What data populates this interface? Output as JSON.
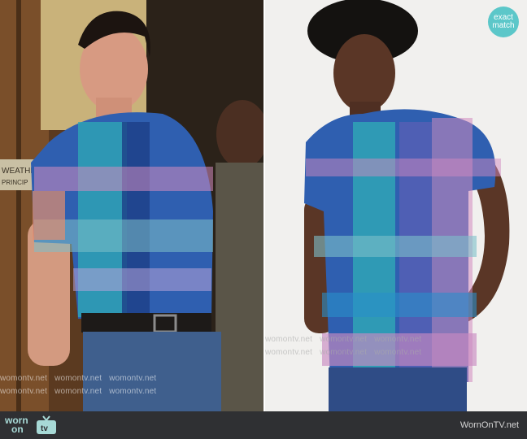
{
  "left_photo": {
    "door_sign_lines": [
      "WEATHE",
      "PRINCIP"
    ],
    "watermarks": [
      "womontv.net",
      "womontv.net",
      "womontv.net",
      "womontv.net",
      "womontv.net",
      "womontv.net"
    ]
  },
  "right_photo": {
    "badge_line1": "exact",
    "badge_line2": "match",
    "watermarks": [
      "womontv.net",
      "womontv.net",
      "womontv.net",
      "womontv.net",
      "womontv.net",
      "womontv.net"
    ]
  },
  "footer": {
    "logo_top": "worn",
    "logo_bottom": "on",
    "logo_tv": "tv",
    "site_name": "WornOnTV.net",
    "bar_color": "#2f3033",
    "logo_color": "#a7d9d6"
  },
  "colors": {
    "badge": "#5cc7c9",
    "shirt_blue": "#2f5fb0",
    "shirt_pink": "#d28ac0",
    "shirt_teal": "#2fa9b6"
  }
}
